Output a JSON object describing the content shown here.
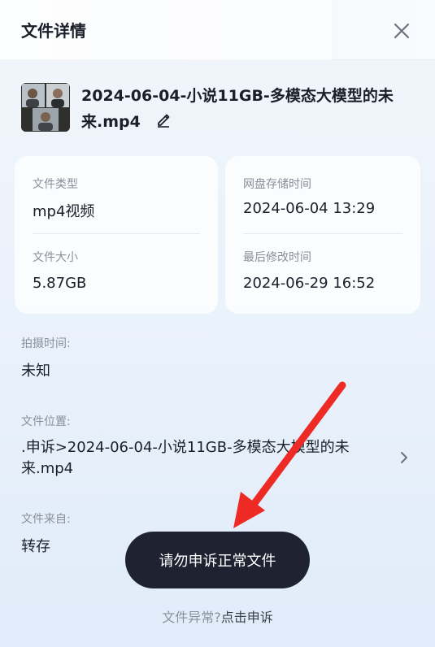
{
  "header": {
    "title": "文件详情"
  },
  "file": {
    "name": "2024-06-04-小说11GB-多模态大模型的未来.mp4"
  },
  "info_card_left": {
    "type_label": "文件类型",
    "type_value": "mp4视频",
    "size_label": "文件大小",
    "size_value": "5.87GB"
  },
  "info_card_right": {
    "stored_label": "网盘存储时间",
    "stored_value": "2024-06-04 13:29",
    "modified_label": "最后修改时间",
    "modified_value": "2024-06-29 16:52"
  },
  "shoot_time": {
    "label": "拍摄时间:",
    "value": "未知"
  },
  "location": {
    "label": "文件位置:",
    "value": ".申诉>2024-06-04-小说11GB-多模态大模型的未来.mp4"
  },
  "source": {
    "label": "文件来自:",
    "value": "转存"
  },
  "toast": {
    "text": "请勿申诉正常文件"
  },
  "footer": {
    "prompt": "文件异常?",
    "link": "点击申诉"
  },
  "colors": {
    "toast_bg": "#1e2231",
    "annotation_arrow": "#ee2a24"
  },
  "icons": [
    "close-icon",
    "edit-pencil-icon",
    "chevron-right-icon"
  ]
}
